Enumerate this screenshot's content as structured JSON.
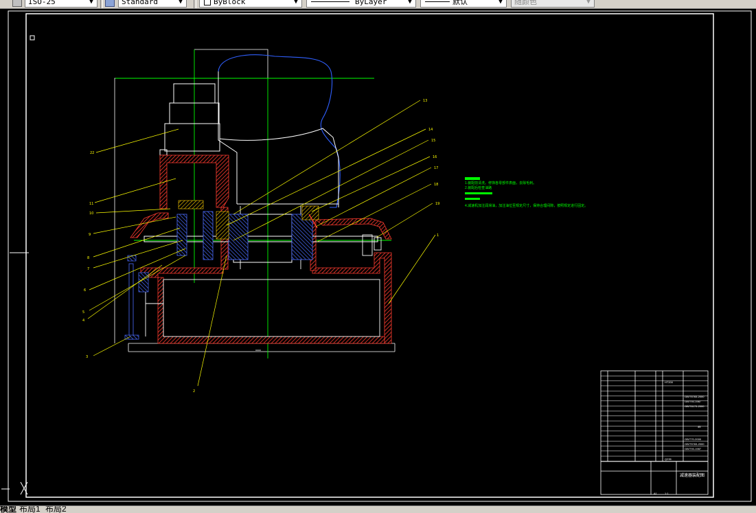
{
  "toolbar": {
    "dimstyle": "ISO-25",
    "textstyle": "Standard",
    "color": "ByBlock",
    "linetype": "ByLayer",
    "lineweight": "默认",
    "plotstyle": "随颜色"
  },
  "drawing": {
    "part_labels": [
      "22",
      "11",
      "10",
      "9",
      "8",
      "7",
      "6",
      "5",
      "4",
      "3",
      "2",
      "13",
      "14",
      "15",
      "16",
      "17",
      "18",
      "19",
      "1"
    ],
    "notes": [
      "1.装配前清洗。修饰各零部件表面，去除毛刺。",
      "2.装配后检查油路",
      "4.减速机加注润滑油，加注油位至规定尺寸，保持合理间隙，按照规定进行固定。"
    ],
    "bom_codes": [
      "GB/T5783-2000",
      "GB/T93-1987",
      "GB/T6170-2000",
      "GB/T70-2000",
      "GB/T5783-2000",
      "GB/T93-1987",
      "GB/T6170-2000",
      "JB/T..."
    ],
    "bom_misc": [
      "HT200",
      "Q235",
      "45"
    ],
    "title_block": {
      "project": "减速器装配图",
      "drawing_no": "A1",
      "sheet": "1:1"
    }
  },
  "layout_tabs": [
    "模型",
    "布局1",
    "布局2"
  ],
  "colors": {
    "background": "#000000",
    "housing": "#ff3b2f",
    "centerline": "#00ff00",
    "leaders": "#ffff00",
    "outline": "#ffffff",
    "hatch_blue": "#4a6cff",
    "motor_blue": "#3060ff"
  }
}
